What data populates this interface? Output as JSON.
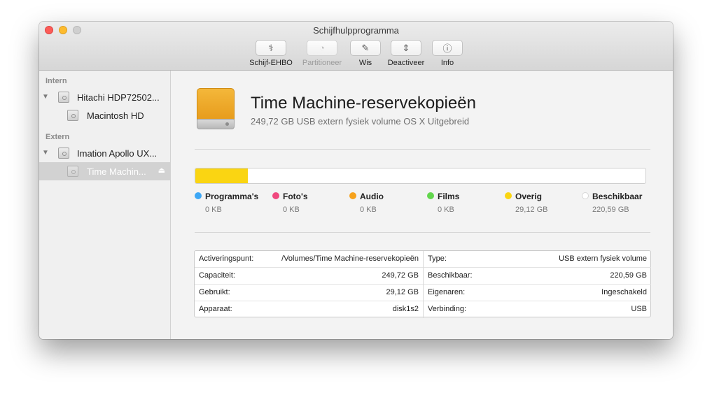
{
  "window": {
    "title": "Schijfhulpprogramma"
  },
  "toolbar": [
    {
      "label": "Schijf-EHBO",
      "icon": "stethoscope-icon",
      "glyph": "⚕",
      "enabled": true
    },
    {
      "label": "Partitioneer",
      "icon": "pie-chart-icon",
      "glyph": "◔",
      "enabled": false
    },
    {
      "label": "Wis",
      "icon": "pencil-erase-icon",
      "glyph": "✎",
      "enabled": true
    },
    {
      "label": "Deactiveer",
      "icon": "unmount-arrows-icon",
      "glyph": "⇕",
      "enabled": true
    },
    {
      "label": "Info",
      "icon": "info-icon",
      "glyph": "ⓘ",
      "enabled": true
    }
  ],
  "sidebar": {
    "sections": [
      {
        "label": "Intern",
        "disks": [
          {
            "name": "Hitachi HDP72502...",
            "volumes": [
              {
                "name": "Macintosh HD",
                "selected": false
              }
            ]
          }
        ]
      },
      {
        "label": "Extern",
        "disks": [
          {
            "name": "Imation Apollo UX...",
            "volumes": [
              {
                "name": "Time Machin...",
                "selected": true
              }
            ]
          }
        ]
      }
    ],
    "eject_glyph": "⏏"
  },
  "volume": {
    "name": "Time Machine-reservekopieën",
    "description": "249,72 GB USB extern fysiek volume OS X Uitgebreid",
    "icon_color": "#f0a92a"
  },
  "usage": {
    "used_fraction": 0.1166,
    "fill_color": "#fad512",
    "categories": [
      {
        "name": "Programma's",
        "value": "0 KB",
        "color": "#3da7f5"
      },
      {
        "name": "Foto's",
        "value": "0 KB",
        "color": "#f0487e"
      },
      {
        "name": "Audio",
        "value": "0 KB",
        "color": "#f6a21c"
      },
      {
        "name": "Films",
        "value": "0 KB",
        "color": "#62d64d"
      },
      {
        "name": "Overig",
        "value": "29,12 GB",
        "color": "#fad512"
      },
      {
        "name": "Beschikbaar",
        "value": "220,59 GB",
        "color": "#ffffff"
      }
    ]
  },
  "info": {
    "left": [
      {
        "key": "Activeringspunt:",
        "value": "/Volumes/Time Machine-reservekopieën"
      },
      {
        "key": "Capaciteit:",
        "value": "249,72 GB"
      },
      {
        "key": "Gebruikt:",
        "value": "29,12 GB"
      },
      {
        "key": "Apparaat:",
        "value": "disk1s2"
      }
    ],
    "right": [
      {
        "key": "Type:",
        "value": "USB extern fysiek volume"
      },
      {
        "key": "Beschikbaar:",
        "value": "220,59 GB"
      },
      {
        "key": "Eigenaren:",
        "value": "Ingeschakeld"
      },
      {
        "key": "Verbinding:",
        "value": "USB"
      }
    ]
  }
}
